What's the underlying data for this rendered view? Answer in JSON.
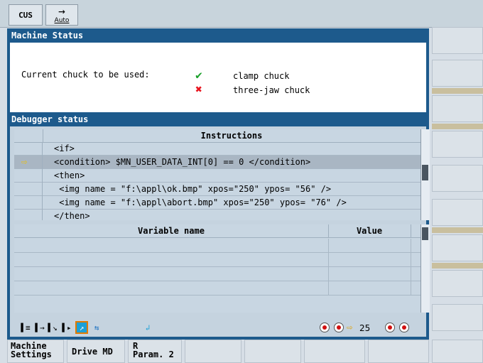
{
  "topbar": {
    "mode": "CUS",
    "auto_label": "Auto",
    "auto_icon": "right-arrow-icon"
  },
  "machine_status": {
    "title": "Machine Status",
    "label": "Current chuck to be used:",
    "options": [
      {
        "icon": "checkmark-icon",
        "color": "#1aa02a",
        "text": "clamp chuck"
      },
      {
        "icon": "cross-icon",
        "color": "#e8141e",
        "text": "three-jaw chuck"
      }
    ]
  },
  "debugger": {
    "title": "Debugger status",
    "instructions_header": "Instructions",
    "instructions": [
      "<if>",
      "<condition> $MN_USER_DATA_INT[0] == 0 </condition>",
      "<then>",
      " <img name = \"f:\\appl\\ok.bmp\" xpos=\"250\" ypos= \"56\" />",
      " <img name = \"f:\\appl\\abort.bmp\" xpos=\"250\" ypos= \"76\" />",
      "</then>"
    ],
    "variable_header": "Variable name",
    "value_header": "Value"
  },
  "toolbar": {
    "step_count": "25"
  },
  "softkeys": {
    "machine_settings": [
      "Machine",
      "Settings"
    ],
    "drive_md": "Drive MD",
    "r_param": [
      "R",
      "Param. 2"
    ]
  },
  "colors": {
    "title_bar": "#1d5a8c",
    "highlight": "#e07a00",
    "arrow": "#f0c000"
  }
}
